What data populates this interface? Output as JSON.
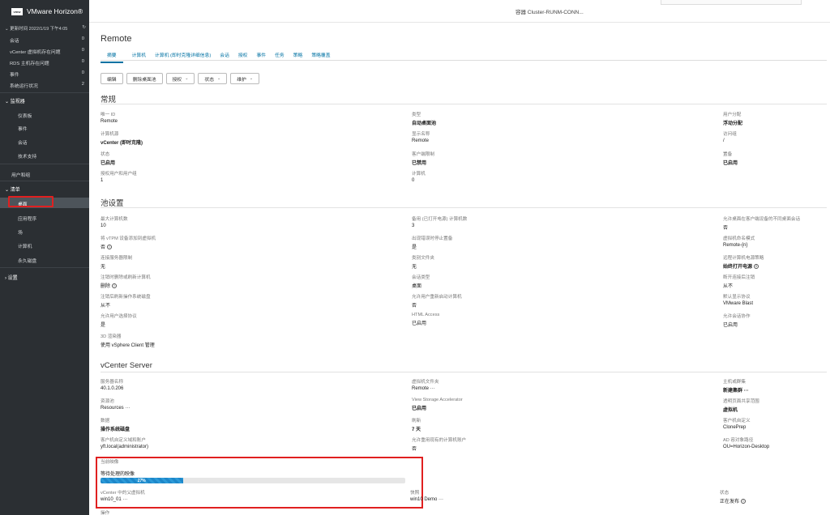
{
  "header": {
    "logo_text": "vmw",
    "app_name": "VMware Horizon®",
    "cluster_label": "容器 Cluster-RUNM-CONN..."
  },
  "sidebar": {
    "update_time": "更新时间 2022/1/19 下午4:05",
    "stats": [
      {
        "label": "会话",
        "count": "0"
      },
      {
        "label": "vCenter 虚拟机存在问题",
        "count": "0"
      },
      {
        "label": "RDS 主机存在问题",
        "count": "0"
      },
      {
        "label": "事件",
        "count": "0"
      },
      {
        "label": "系统运行状况",
        "count": "2"
      }
    ],
    "monitor": {
      "label": "监视器",
      "items": [
        "仪表板",
        "事件",
        "会话",
        "技术支持"
      ]
    },
    "users_groups": "用户和组",
    "inventory": {
      "label": "清单",
      "items": [
        "桌面",
        "应用程序",
        "场",
        "计算机",
        "永久磁盘"
      ]
    },
    "settings": "设置"
  },
  "main": {
    "title": "Remote",
    "tabs": [
      "摘要",
      "计算机",
      "计算机 (即时克隆详细信息)",
      "会话",
      "授权",
      "事件",
      "任务",
      "策略",
      "策略覆盖"
    ],
    "toolbar": {
      "edit": "编辑",
      "delete": "删除桌面池",
      "entitle": "授权",
      "status": "状态",
      "maintain": "维护"
    },
    "general": {
      "title": "常规",
      "unique_id_label": "唯一 ID",
      "unique_id": "Remote",
      "type_label": "类型",
      "type": "自动桌面池",
      "user_assign_label": "用户分配",
      "user_assign": "浮动分配",
      "source_label": "计算机源",
      "source": "vCenter (即时克隆)",
      "display_name_label": "显示名称",
      "display_name": "Remote",
      "access_group_label": "访问组",
      "access_group": "/",
      "state_label": "状态",
      "state": "已启用",
      "client_restrict_label": "客户端限制",
      "client_restrict": "已禁用",
      "favorite_label": "置备",
      "favorite": "已启用",
      "users_groups_label": "授权用户和用户组",
      "users_groups": "1",
      "computers_label": "计算机",
      "computers": "0"
    },
    "pool": {
      "title": "池设置",
      "max_label": "最大计算机数",
      "max": "10",
      "spare_label": "备用 (已打开电源) 计算机数",
      "spare": "3",
      "allow_session_label": "允许桌面在客户端设备的不同桌面会话",
      "allow_session": "否",
      "vtpm_label": "将 vTPM 设备添加到虚拟机",
      "vtpm": "否",
      "stop_on_error_label": "出现错误时停止置备",
      "stop_on_error": "是",
      "naming_label": "虚拟机命名模式",
      "naming": "Remote-{n}",
      "connection_label": "连接服务器限制",
      "connection": "无",
      "category_label": "类别文件夹",
      "category": "无",
      "remote_power_label": "远程计算机电源策略",
      "remote_power": "始终打开电源",
      "logoff_label": "注销时删除或刷新计算机",
      "logoff": "删除",
      "session_type_label": "会话类型",
      "session_type": "桌面",
      "disconnect_label": "断开连接后注销",
      "disconnect": "从不",
      "reconnect_label": "注销后刷新操作系统磁盘",
      "reconnect": "从不",
      "restart_label": "允许用户重新启动计算机",
      "restart": "否",
      "default_protocol_label": "默认显示协议",
      "default_protocol": "VMware Blast",
      "choose_protocol_label": "允许用户选择协议",
      "choose_protocol": "是",
      "html_label": "HTML Access",
      "html": "已启用",
      "session_collab_label": "允许会话协作",
      "session_collab": "已启用",
      "renderer_label": "3D 渲染器",
      "renderer": "使用 vSphere Client 管理"
    },
    "vcenter": {
      "title": "vCenter Server",
      "server_label": "服务器名称",
      "server": "40.1.0.206",
      "vm_folder_label": "虚拟机文件夹",
      "vm_folder": "Remote ···",
      "host_cluster_label": "主机或群集",
      "host_cluster": "新建集群 ···",
      "resource_pool_label": "资源池",
      "resource_pool": "Resources ···",
      "accelerator_label": "View Storage Accelerator",
      "accelerator": "已启用",
      "transparent_page_label": "透明页面共享范围",
      "transparent_page": "虚拟机",
      "datastore_label": "数据",
      "datastore": "操作系统磁盘",
      "refresh_label": "刷新",
      "refresh": "7 天",
      "customization_label": "客户机自定义",
      "customization": "ClonePrep",
      "domain_account_label": "客户机自定义域和账户",
      "domain_account": "yft.local(administrator)",
      "allow_reuse_label": "允许重用现有的计算机账户",
      "allow_reuse": "否",
      "ad_container_label": "AD 容对象路径",
      "ad_container": "OU=Horizon-Desktop"
    },
    "current_image": {
      "label": "当前映像",
      "pending_label": "等待处理的映像",
      "progress_percent": 27,
      "progress_text": "27%",
      "vm_label": "vCenter 中的父虚拟机",
      "vm": "win10_01 ···",
      "snapshot_label": "快照",
      "snapshot": "win10 Demo ···",
      "status_label": "状态",
      "status": "正在发布"
    },
    "operations_label": "操作"
  }
}
